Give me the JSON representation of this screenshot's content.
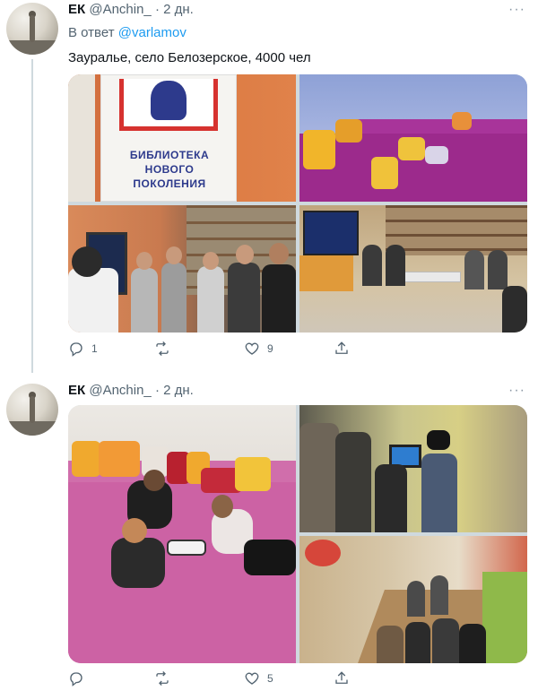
{
  "tweets": [
    {
      "display_name": "ЕК",
      "handle": "@Anchin_",
      "separator": "·",
      "age": "2 дн.",
      "more": "···",
      "reply_prefix": "В ответ",
      "reply_to": "@varlamov",
      "text": "Зауралье, село Белозерское, 4000 чел",
      "sign_lines": [
        "БИБЛИОТЕКА",
        "НОВОГО",
        "ПОКОЛЕНИЯ"
      ],
      "replies": "1",
      "retweets": "",
      "likes": "9"
    },
    {
      "display_name": "ЕК",
      "handle": "@Anchin_",
      "separator": "·",
      "age": "2 дн.",
      "more": "···",
      "replies": "",
      "retweets": "",
      "likes": "5"
    }
  ]
}
